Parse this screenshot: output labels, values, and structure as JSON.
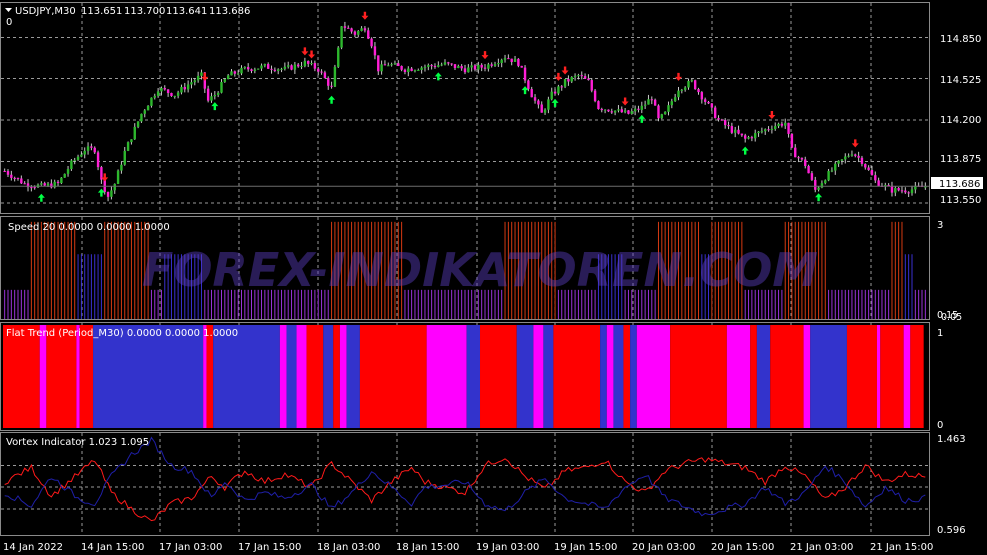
{
  "chart_data": [
    {
      "type": "candlestick",
      "symbol_label": "USDJPY,M30",
      "ohlc_readout": [
        "113.651",
        "113.700",
        "113.641",
        "113.686"
      ],
      "sub_label": "0",
      "current_price": "113.686",
      "y_ticks": [
        "114.850",
        "114.525",
        "114.200",
        "113.875",
        "113.550"
      ],
      "y_tick_values": [
        114.85,
        114.525,
        114.2,
        113.875,
        113.55
      ],
      "ylim": [
        113.47,
        115.12
      ],
      "colors": {
        "up": "#2db82d",
        "down": "#ff1fd6",
        "wick": "#c8c8c8",
        "arrow_up": "#00ff44",
        "arrow_down": "#ff2020",
        "price_line": "#6d6d6d"
      },
      "grid": true,
      "close_path": [
        [
          0,
          113.8
        ],
        [
          6,
          113.7
        ],
        [
          11,
          113.68
        ],
        [
          16,
          113.7
        ],
        [
          20,
          113.86
        ],
        [
          24,
          113.97
        ],
        [
          27,
          113.97
        ],
        [
          29,
          113.72
        ],
        [
          31,
          113.6
        ],
        [
          33,
          113.7
        ],
        [
          36,
          113.95
        ],
        [
          41,
          114.25
        ],
        [
          46,
          114.45
        ],
        [
          51,
          114.4
        ],
        [
          56,
          114.5
        ],
        [
          59,
          114.55
        ],
        [
          61,
          114.35
        ],
        [
          63,
          114.4
        ],
        [
          67,
          114.55
        ],
        [
          72,
          114.6
        ],
        [
          78,
          114.62
        ],
        [
          84,
          114.6
        ],
        [
          90,
          114.65
        ],
        [
          94,
          114.6
        ],
        [
          98,
          114.45
        ],
        [
          100,
          114.75
        ],
        [
          101,
          114.95
        ],
        [
          105,
          114.88
        ],
        [
          108,
          114.93
        ],
        [
          110,
          114.8
        ],
        [
          112,
          114.6
        ],
        [
          115,
          114.64
        ],
        [
          120,
          114.6
        ],
        [
          126,
          114.62
        ],
        [
          132,
          114.64
        ],
        [
          138,
          114.6
        ],
        [
          144,
          114.62
        ],
        [
          150,
          114.7
        ],
        [
          154,
          114.65
        ],
        [
          158,
          114.4
        ],
        [
          161,
          114.25
        ],
        [
          164,
          114.4
        ],
        [
          168,
          114.5
        ],
        [
          172,
          114.55
        ],
        [
          175,
          114.5
        ],
        [
          178,
          114.3
        ],
        [
          182,
          114.28
        ],
        [
          187,
          114.25
        ],
        [
          191,
          114.3
        ],
        [
          194,
          114.38
        ],
        [
          196,
          114.2
        ],
        [
          198,
          114.25
        ],
        [
          202,
          114.45
        ],
        [
          206,
          114.5
        ],
        [
          210,
          114.35
        ],
        [
          214,
          114.2
        ],
        [
          218,
          114.12
        ],
        [
          222,
          114.05
        ],
        [
          226,
          114.1
        ],
        [
          230,
          114.15
        ],
        [
          234,
          114.18
        ],
        [
          236,
          113.96
        ],
        [
          240,
          113.85
        ],
        [
          243,
          113.65
        ],
        [
          246,
          113.75
        ],
        [
          250,
          113.86
        ],
        [
          254,
          113.95
        ],
        [
          257,
          113.88
        ],
        [
          261,
          113.72
        ],
        [
          266,
          113.65
        ],
        [
          271,
          113.65
        ],
        [
          276,
          113.68
        ]
      ],
      "arrows_up": [
        11,
        29,
        63,
        98,
        130,
        156,
        165,
        191,
        222,
        244
      ],
      "arrows_down": [
        30,
        60,
        90,
        92,
        108,
        144,
        166,
        168,
        186,
        202,
        230,
        255
      ]
    },
    {
      "type": "bar",
      "label": "Speed 20 0.0000 0.0000 1.0000",
      "y_ticks": [
        "3",
        "0.15",
        "0.05"
      ],
      "y_tick_values": [
        3,
        0.15,
        0.05
      ],
      "ylim": [
        0,
        3.15
      ],
      "colors": {
        "strong": "#d63a12",
        "medium": "#3a2fd0",
        "weak": "#9a33d9"
      },
      "levels": {
        "strong": 3.0,
        "medium": 2.0,
        "weak": 0.9
      },
      "segments": [
        [
          "weak",
          0,
          8
        ],
        [
          "strong",
          8,
          22
        ],
        [
          "medium",
          22,
          30
        ],
        [
          "strong",
          30,
          44
        ],
        [
          "weak",
          44,
          48
        ],
        [
          "medium",
          48,
          60
        ],
        [
          "weak",
          60,
          98
        ],
        [
          "strong",
          98,
          120
        ],
        [
          "weak",
          120,
          150
        ],
        [
          "strong",
          150,
          166
        ],
        [
          "weak",
          166,
          178
        ],
        [
          "medium",
          178,
          186
        ],
        [
          "weak",
          186,
          196
        ],
        [
          "strong",
          196,
          209
        ],
        [
          "medium",
          209,
          212
        ],
        [
          "strong",
          212,
          222
        ],
        [
          "weak",
          222,
          234
        ],
        [
          "strong",
          234,
          247
        ],
        [
          "weak",
          247,
          266
        ],
        [
          "strong",
          266,
          270
        ],
        [
          "medium",
          270,
          273
        ],
        [
          "weak",
          273,
          277
        ]
      ],
      "watermark": "FOREX-INDIKATOREN.COM"
    },
    {
      "type": "heatmap",
      "label": "Flat Trend (Period_M30) 0.0000 0.0000 1.0000",
      "y_ticks": [
        "1",
        "0"
      ],
      "colors": {
        "red": "#ff0000",
        "blue": "#3333cc",
        "magenta": "#ff00ff"
      },
      "segments": [
        [
          "red",
          0,
          11
        ],
        [
          "magenta",
          11,
          13
        ],
        [
          "red",
          13,
          22
        ],
        [
          "magenta",
          22,
          23
        ],
        [
          "red",
          23,
          27
        ],
        [
          "blue",
          27,
          60
        ],
        [
          "magenta",
          60,
          61
        ],
        [
          "red",
          61,
          63
        ],
        [
          "blue",
          63,
          83
        ],
        [
          "magenta",
          83,
          85
        ],
        [
          "blue",
          85,
          88
        ],
        [
          "magenta",
          88,
          91
        ],
        [
          "red",
          91,
          96
        ],
        [
          "blue",
          96,
          99
        ],
        [
          "red",
          99,
          101
        ],
        [
          "magenta",
          101,
          103
        ],
        [
          "blue",
          103,
          107
        ],
        [
          "red",
          107,
          127
        ],
        [
          "magenta",
          127,
          139
        ],
        [
          "blue",
          139,
          143
        ],
        [
          "red",
          143,
          154
        ],
        [
          "blue",
          154,
          159
        ],
        [
          "magenta",
          159,
          162
        ],
        [
          "blue",
          162,
          165
        ],
        [
          "red",
          165,
          179
        ],
        [
          "blue",
          179,
          181
        ],
        [
          "magenta",
          181,
          183
        ],
        [
          "blue",
          183,
          186
        ],
        [
          "red",
          186,
          188
        ],
        [
          "blue",
          188,
          190
        ],
        [
          "magenta",
          190,
          200
        ],
        [
          "red",
          200,
          217
        ],
        [
          "magenta",
          217,
          224
        ],
        [
          "red",
          224,
          226
        ],
        [
          "blue",
          226,
          230
        ],
        [
          "red",
          230,
          240
        ],
        [
          "magenta",
          240,
          242
        ],
        [
          "blue",
          242,
          253
        ],
        [
          "red",
          253,
          262
        ],
        [
          "magenta",
          262,
          263
        ],
        [
          "red",
          263,
          270
        ],
        [
          "magenta",
          270,
          272
        ],
        [
          "red",
          272,
          276
        ]
      ]
    },
    {
      "type": "line",
      "label": "Vortex Indicator 1.023 1.095",
      "y_ticks": [
        "1.463",
        "0.596"
      ],
      "y_tick_values": [
        1.463,
        0.596
      ],
      "ylim": [
        0.596,
        1.463
      ],
      "series": [
        {
          "color": "#ff1a1a",
          "points": [
            [
              0,
              1.05
            ],
            [
              8,
              1.18
            ],
            [
              14,
              0.92
            ],
            [
              22,
              1.12
            ],
            [
              27,
              1.25
            ],
            [
              32,
              0.95
            ],
            [
              38,
              0.8
            ],
            [
              44,
              0.68
            ],
            [
              50,
              0.85
            ],
            [
              56,
              0.9
            ],
            [
              62,
              1.1
            ],
            [
              66,
              1.0
            ],
            [
              72,
              1.15
            ],
            [
              78,
              1.05
            ],
            [
              84,
              1.12
            ],
            [
              92,
              1.0
            ],
            [
              98,
              1.22
            ],
            [
              104,
              1.05
            ],
            [
              110,
              0.88
            ],
            [
              116,
              1.05
            ],
            [
              122,
              1.18
            ],
            [
              126,
              1.05
            ],
            [
              132,
              1.0
            ],
            [
              138,
              0.95
            ],
            [
              144,
              1.2
            ],
            [
              150,
              1.28
            ],
            [
              156,
              1.1
            ],
            [
              162,
              0.98
            ],
            [
              168,
              1.15
            ],
            [
              174,
              1.18
            ],
            [
              180,
              1.25
            ],
            [
              186,
              1.05
            ],
            [
              192,
              0.95
            ],
            [
              198,
              1.15
            ],
            [
              204,
              1.22
            ],
            [
              210,
              1.26
            ],
            [
              216,
              1.22
            ],
            [
              222,
              1.18
            ],
            [
              228,
              1.05
            ],
            [
              234,
              1.2
            ],
            [
              240,
              1.1
            ],
            [
              246,
              0.88
            ],
            [
              252,
              1.0
            ],
            [
              258,
              1.2
            ],
            [
              264,
              1.05
            ],
            [
              270,
              1.12
            ],
            [
              276,
              1.1
            ]
          ]
        },
        {
          "color": "#1f1fa8",
          "points": [
            [
              0,
              0.95
            ],
            [
              8,
              0.83
            ],
            [
              14,
              1.1
            ],
            [
              22,
              0.9
            ],
            [
              27,
              0.85
            ],
            [
              32,
              1.1
            ],
            [
              38,
              1.3
            ],
            [
              44,
              1.43
            ],
            [
              50,
              1.2
            ],
            [
              56,
              1.15
            ],
            [
              62,
              0.9
            ],
            [
              66,
              1.05
            ],
            [
              72,
              0.88
            ],
            [
              78,
              0.95
            ],
            [
              84,
              0.9
            ],
            [
              92,
              1.02
            ],
            [
              98,
              0.8
            ],
            [
              104,
              0.95
            ],
            [
              110,
              1.15
            ],
            [
              116,
              1.0
            ],
            [
              122,
              0.85
            ],
            [
              126,
              1.0
            ],
            [
              132,
              1.02
            ],
            [
              138,
              1.05
            ],
            [
              144,
              0.85
            ],
            [
              150,
              0.78
            ],
            [
              156,
              0.95
            ],
            [
              162,
              1.08
            ],
            [
              168,
              0.9
            ],
            [
              174,
              0.85
            ],
            [
              180,
              0.8
            ],
            [
              186,
              1.0
            ],
            [
              192,
              1.12
            ],
            [
              198,
              0.9
            ],
            [
              204,
              0.82
            ],
            [
              210,
              0.75
            ],
            [
              216,
              0.8
            ],
            [
              222,
              0.85
            ],
            [
              228,
              1.0
            ],
            [
              234,
              0.85
            ],
            [
              240,
              0.95
            ],
            [
              246,
              1.2
            ],
            [
              252,
              1.05
            ],
            [
              258,
              0.82
            ],
            [
              264,
              1.0
            ],
            [
              270,
              0.88
            ],
            [
              276,
              0.9
            ]
          ]
        }
      ]
    }
  ],
  "time_axis": [
    "14 Jan 2022",
    "14 Jan 15:00",
    "17 Jan 03:00",
    "17 Jan 15:00",
    "18 Jan 03:00",
    "18 Jan 15:00",
    "19 Jan 03:00",
    "19 Jan 15:00",
    "20 Jan 03:00",
    "20 Jan 15:00",
    "21 Jan 03:00",
    "21 Jan 15:00"
  ],
  "bar_count": 277
}
